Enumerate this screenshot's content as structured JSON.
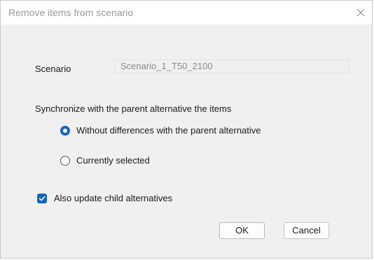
{
  "dialog": {
    "title": "Remove items from scenario",
    "close_icon": "close-icon"
  },
  "scenario": {
    "label": "Scenario",
    "value": "Scenario_1_T50_2100"
  },
  "sync": {
    "heading": "Synchronize with the parent alternative the items",
    "options": [
      {
        "label": "Without differences with the parent alternative",
        "selected": true
      },
      {
        "label": "Currently selected",
        "selected": false
      }
    ]
  },
  "child_update": {
    "label": "Also update child alternatives",
    "checked": true
  },
  "buttons": {
    "ok_label": "OK",
    "cancel_label": "Cancel"
  },
  "colors": {
    "accent": "#1766b8",
    "dialog_bg": "#f0f0f0",
    "titlebar_bg": "#ffffff"
  }
}
